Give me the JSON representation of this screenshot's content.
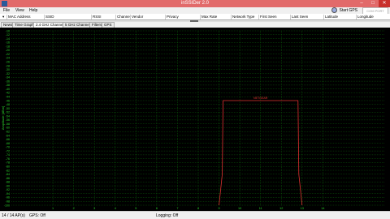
{
  "window": {
    "title": "inSSIDer 2.0"
  },
  "window_buttons": [
    "–",
    "□",
    "✕"
  ],
  "menu": [
    "File",
    "View",
    "Help"
  ],
  "gps": {
    "label": "Start GPS",
    "placeholder": "COM PORT"
  },
  "columns": [
    "MAC Address",
    "SSID",
    "RSSI",
    "Channel",
    "Vendor",
    "Privacy",
    "Max Rate",
    "Network Type",
    "First Seen",
    "Last Seen",
    "Latitude",
    "Longitude"
  ],
  "tabs": [
    "News",
    "Time Graph",
    "2.4 GHz Channels",
    "5 GHz Channels",
    "Filters",
    "GPS"
  ],
  "active_tab": 2,
  "status": {
    "ap_count": "14 / 14 AP(s)",
    "gps": "GPS: Off",
    "logging": "Logging: Off"
  },
  "colors": {
    "titlebar": "#e26a6a",
    "grid": "#0a5a0a",
    "axis_text": "#2bd32b",
    "network": "#e03030",
    "plot_bg": "#000000"
  },
  "chart_data": {
    "type": "area",
    "title": "",
    "xlabel": "",
    "ylabel": "Amplitude [dBm]",
    "x_ticks": [
      1,
      2,
      3,
      4,
      5,
      6,
      7,
      8,
      9,
      10,
      11,
      12,
      13,
      14
    ],
    "ylim": [
      -100,
      -10
    ],
    "y_step": 2,
    "grid": true,
    "series": [
      {
        "name": "NETGEAR",
        "channel": 11,
        "x_from": 9,
        "x_to": 13,
        "peak_dbm": -46,
        "floor_dbm": -100
      }
    ]
  }
}
